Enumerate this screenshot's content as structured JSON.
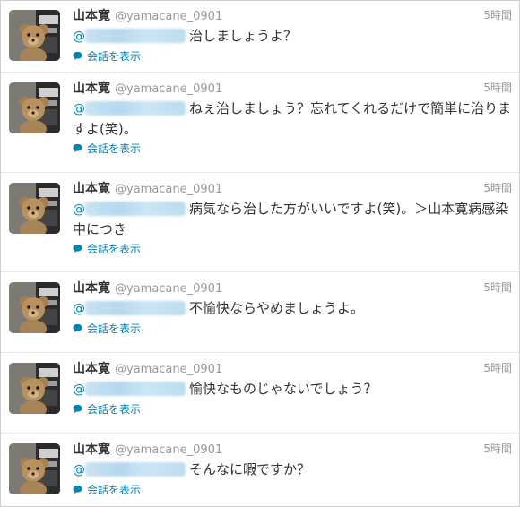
{
  "tweets": [
    {
      "display_name": "山本寛",
      "screen_name": "@yamacane_0901",
      "time": "5時間",
      "mention": "@",
      "text": "治しましょうよ？",
      "convo": "会話を表示"
    },
    {
      "display_name": "山本寛",
      "screen_name": "@yamacane_0901",
      "time": "5時間",
      "mention": "@",
      "text": "ねぇ治しましょう？忘れてくれるだけで簡単に治りますよ(笑)。",
      "convo": "会話を表示"
    },
    {
      "display_name": "山本寛",
      "screen_name": "@yamacane_0901",
      "time": "5時間",
      "mention": "@",
      "text": "病気なら治した方がいいですよ(笑)。＞山本寛病感染中につき",
      "convo": "会話を表示"
    },
    {
      "display_name": "山本寛",
      "screen_name": "@yamacane_0901",
      "time": "5時間",
      "mention": "@",
      "text": "不愉快ならやめましょうよ。",
      "convo": "会話を表示"
    },
    {
      "display_name": "山本寛",
      "screen_name": "@yamacane_0901",
      "time": "5時間",
      "mention": "@",
      "text": "愉快なものじゃないでしょう？",
      "convo": "会話を表示"
    },
    {
      "display_name": "山本寛",
      "screen_name": "@yamacane_0901",
      "time": "5時間",
      "mention": "@",
      "text": "そんなに暇ですか？",
      "convo": "会話を表示"
    }
  ],
  "colors": {
    "link": "#0084b4",
    "meta": "#999999",
    "text": "#333333"
  },
  "icons": {
    "avatar": "teddy-bear-avatar-icon",
    "convo": "speech-bubble-icon"
  }
}
